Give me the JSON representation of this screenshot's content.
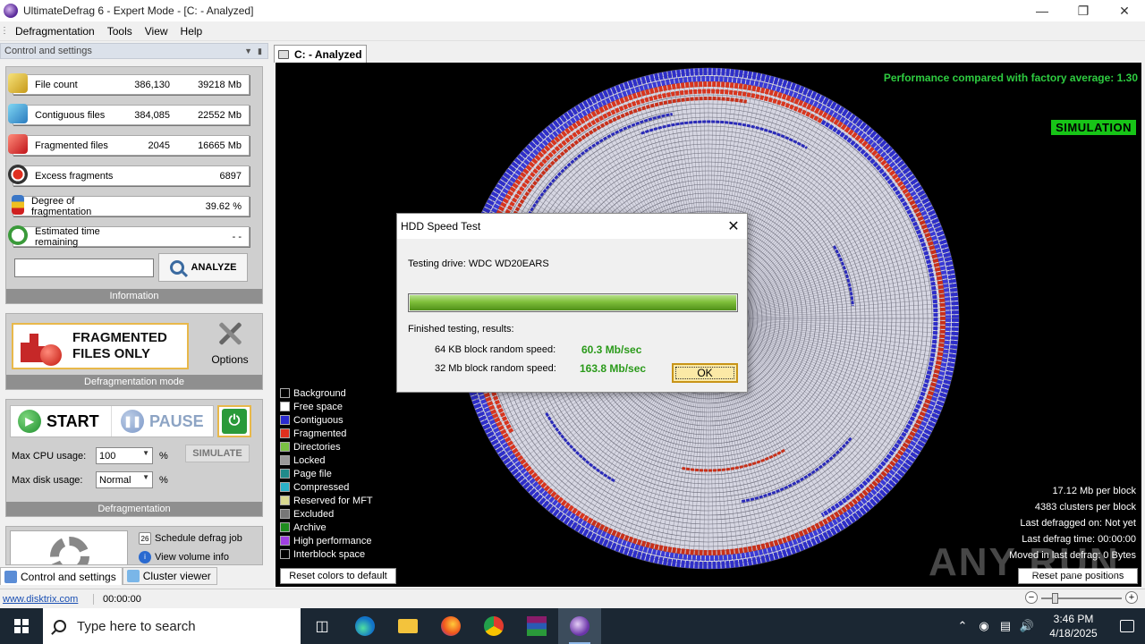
{
  "window": {
    "title": "UltimateDefrag 6 - Expert Mode - [C: - Analyzed]"
  },
  "menu": [
    "Defragmentation",
    "Tools",
    "View",
    "Help"
  ],
  "left_panel": {
    "header": "Control and settings",
    "stats": [
      {
        "label": "File count",
        "value1": "386,130",
        "value2": "39218 Mb",
        "icon": "files-icon"
      },
      {
        "label": "Contiguous files",
        "value1": "384,085",
        "value2": "22552 Mb",
        "icon": "contiguous-icon"
      },
      {
        "label": "Fragmented files",
        "value1": "2045",
        "value2": "16665 Mb",
        "icon": "fragmented-icon"
      },
      {
        "label": "Excess fragments",
        "value1": "",
        "value2": "6897",
        "icon": "excess-icon"
      },
      {
        "label": "Degree of fragmentation",
        "value1": "",
        "value2": "39.62 %",
        "icon": "degree-icon"
      },
      {
        "label": "Estimated time remaining",
        "value1": "",
        "value2": "- -",
        "icon": "timer-icon"
      }
    ],
    "analyze_label": "ANALYZE",
    "information_label": "Information",
    "mode": {
      "line1": "FRAGMENTED",
      "line2": "FILES ONLY",
      "options_label": "Options",
      "section_label": "Defragmentation mode"
    },
    "defrag": {
      "start_label": "START",
      "pause_label": "PAUSE",
      "cpu_label": "Max CPU usage:",
      "cpu_value": "100",
      "disk_label": "Max disk usage:",
      "disk_value": "Normal",
      "percent": "%",
      "simulate_label": "SIMULATE",
      "section_label": "Defragmentation"
    },
    "links": {
      "schedule": "Schedule defrag job",
      "volume_info": "View volume info"
    }
  },
  "bottom_tabs": [
    "Control and settings",
    "Cluster viewer"
  ],
  "status": {
    "link": "www.disktrix.com",
    "time": "00:00:00"
  },
  "document_tab": "C: - Analyzed",
  "viewer": {
    "performance": "Performance compared with factory average: 1.30",
    "simulation_badge": "SIMULATION",
    "legend": [
      {
        "label": "Background",
        "color": "#000000"
      },
      {
        "label": "Free space",
        "color": "#ffffff"
      },
      {
        "label": "Contiguous",
        "color": "#2a2ad0"
      },
      {
        "label": "Fragmented",
        "color": "#e0301e"
      },
      {
        "label": "Directories",
        "color": "#7ac143"
      },
      {
        "label": "Locked",
        "color": "#9a9a9a"
      },
      {
        "label": "Page file",
        "color": "#208a8a"
      },
      {
        "label": "Compressed",
        "color": "#2ab0c8"
      },
      {
        "label": "Reserved for MFT",
        "color": "#d8d890"
      },
      {
        "label": "Excluded",
        "color": "#777777"
      },
      {
        "label": "Archive",
        "color": "#1e8c1e"
      },
      {
        "label": "High performance",
        "color": "#a040e0"
      },
      {
        "label": "Interblock space",
        "color": "#000000"
      }
    ],
    "reset_colors": "Reset colors to default",
    "reset_pane": "Reset pane positions",
    "info": [
      "17.12 Mb per block",
      "4383 clusters per block",
      "Last defragged on: Not yet",
      "Last defrag time: 00:00:00",
      "Moved in last defrag: 0 Bytes"
    ],
    "watermark": "ANY RUN"
  },
  "dialog": {
    "title": "HDD Speed Test",
    "testing": "Testing drive: WDC WD20EARS",
    "progress": 1.0,
    "finished": "Finished testing, results:",
    "r1_label": "64 KB block random speed:",
    "r1_value": "60.3 Mb/sec",
    "r2_label": "32 Mb block random speed:",
    "r2_value": "163.8 Mb/sec",
    "ok_label": "OK"
  },
  "taskbar": {
    "search_placeholder": "Type here to search",
    "time": "3:46 PM",
    "date": "4/18/2025"
  }
}
